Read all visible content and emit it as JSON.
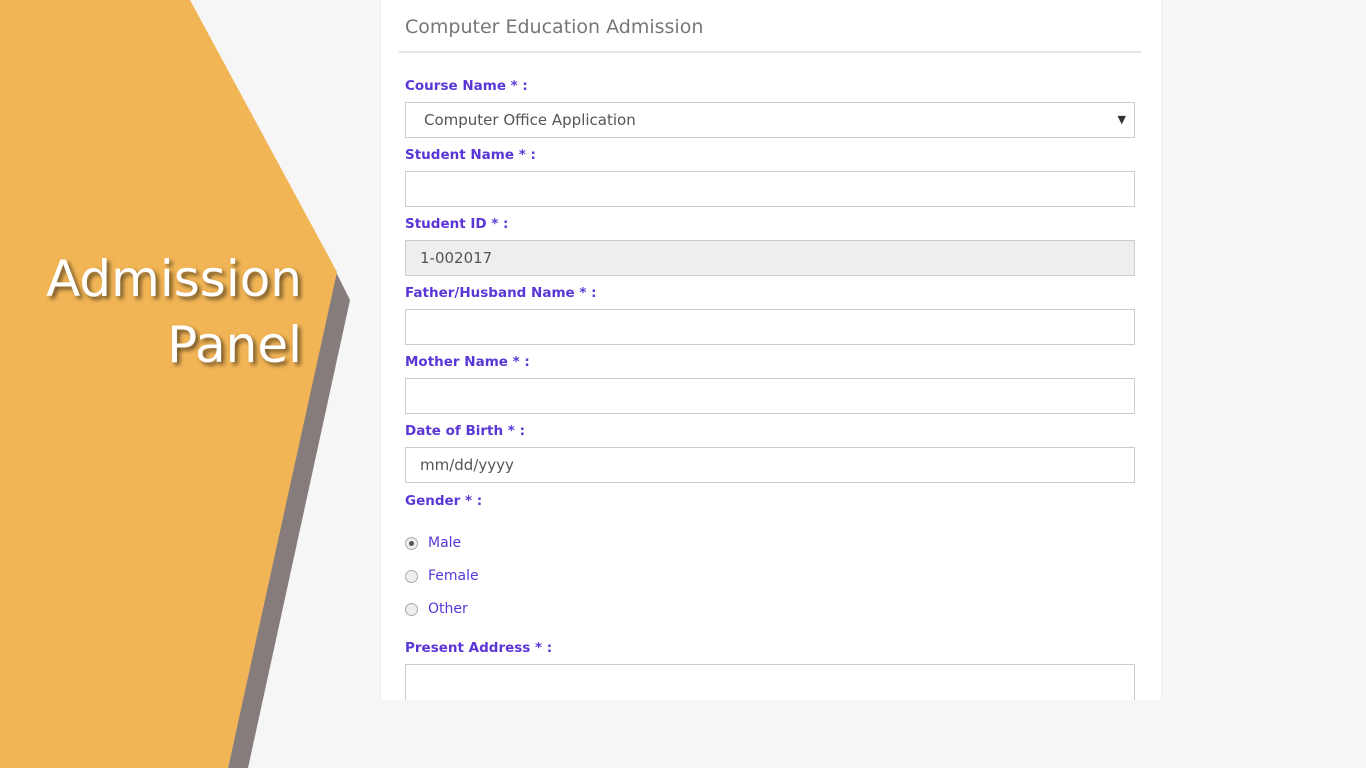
{
  "hero": {
    "line1": "Admission",
    "line2": "Panel"
  },
  "form": {
    "title": "Computer Education Admission",
    "course": {
      "label": "Course Name * :",
      "value": "Computer Office Application"
    },
    "student_name": {
      "label": "Student Name * :",
      "value": ""
    },
    "student_id": {
      "label": "Student ID * :",
      "value": "1-002017"
    },
    "father": {
      "label": "Father/Husband Name * :",
      "value": ""
    },
    "mother": {
      "label": "Mother Name * :",
      "value": ""
    },
    "dob": {
      "label": "Date of Birth * :",
      "placeholder": "mm/dd/yyyy"
    },
    "gender": {
      "label": "Gender * :",
      "options": [
        "Male",
        "Female",
        "Other"
      ],
      "selected": "Male"
    },
    "address": {
      "label": "Present Address * :",
      "value": ""
    }
  },
  "colors": {
    "accent": "#f2b555",
    "shadow": "#877c7c",
    "label": "#5a36d6"
  }
}
